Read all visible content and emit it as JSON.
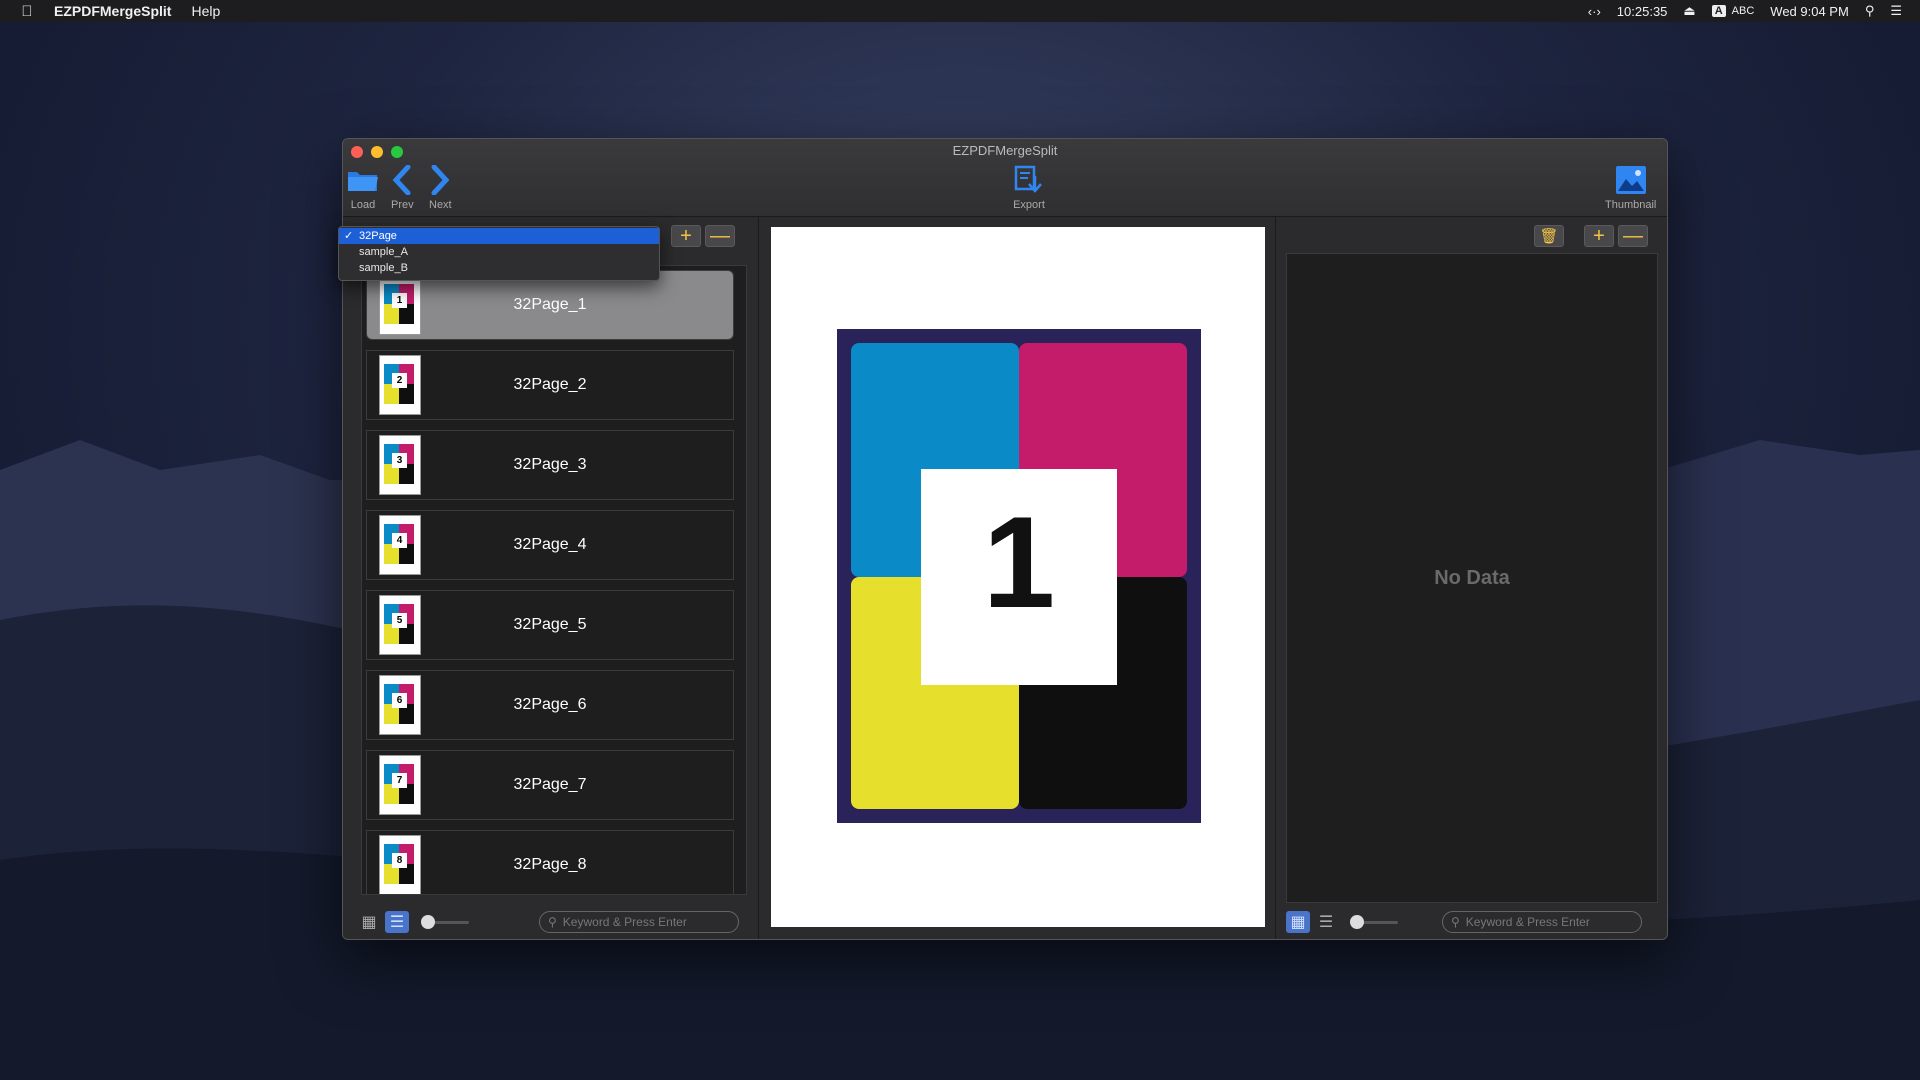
{
  "menubar": {
    "app_name": "EZPDFMergeSplit",
    "menus": [
      "Help"
    ],
    "clock": "10:25:35",
    "input_source": "ABC",
    "input_badge": "A",
    "datetime": "Wed 9:04 PM"
  },
  "window": {
    "title": "EZPDFMergeSplit",
    "toolbar": {
      "load_label": "Load",
      "prev_label": "Prev",
      "next_label": "Next",
      "export_label": "Export",
      "thumbnail_label": "Thumbnail"
    }
  },
  "dropdown": {
    "options": [
      "32Page",
      "sample_A",
      "sample_B"
    ],
    "selected": "32Page"
  },
  "left_list": {
    "items": [
      {
        "label": "32Page_1",
        "num": "1"
      },
      {
        "label": "32Page_2",
        "num": "2"
      },
      {
        "label": "32Page_3",
        "num": "3"
      },
      {
        "label": "32Page_4",
        "num": "4"
      },
      {
        "label": "32Page_5",
        "num": "5"
      },
      {
        "label": "32Page_6",
        "num": "6"
      },
      {
        "label": "32Page_7",
        "num": "7"
      },
      {
        "label": "32Page_8",
        "num": "8"
      }
    ],
    "selected_index": 0,
    "search_placeholder": "Keyword & Press Enter"
  },
  "preview": {
    "page_number": "1",
    "colors": {
      "cyan": "#0a8ac6",
      "magenta": "#c41c6a",
      "yellow": "#e6e02c",
      "black": "#0f0f0f",
      "frame": "#2a235a"
    }
  },
  "right_panel": {
    "empty_text": "No Data",
    "search_placeholder": "Keyword & Press Enter"
  },
  "accent": "#f5c542"
}
